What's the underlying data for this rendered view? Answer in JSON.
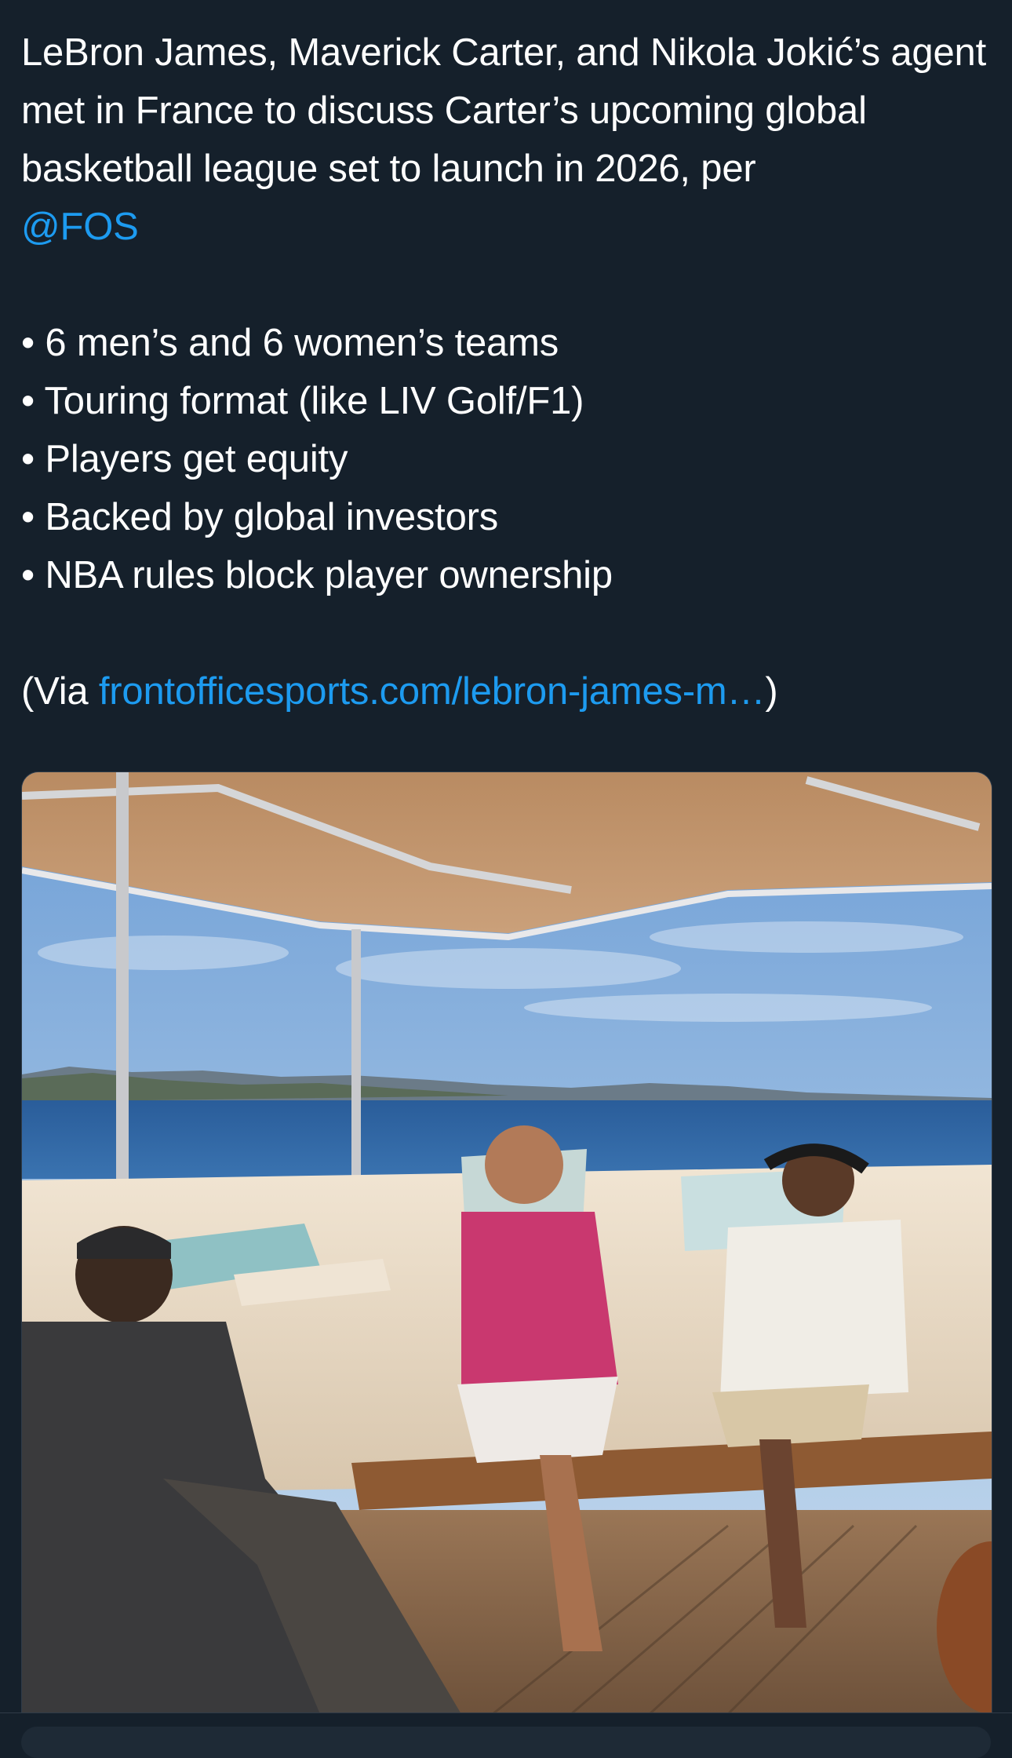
{
  "tweet": {
    "intro": "LeBron James, Maverick Carter, and Nikola Jokić’s agent met in France to discuss Carter’s upcoming global basketball league set to launch in 2026, per",
    "mention": "@FOS",
    "bullets": [
      "• 6 men’s and 6 women’s teams",
      "• Touring format (like LIV Golf/F1)",
      "• Players get equity",
      "• Backed by global investors",
      "• NBA rules block player ownership"
    ],
    "via_prefix": "(Via ",
    "via_link": "frontofficesports.com/lebron-james-m…",
    "via_suffix": ")"
  },
  "media": {
    "kind": "photo",
    "subject": "three men seated on a yacht deck under a canopy"
  },
  "colors": {
    "background": "#15202b",
    "text": "#ffffff",
    "link": "#1d9bf0"
  }
}
